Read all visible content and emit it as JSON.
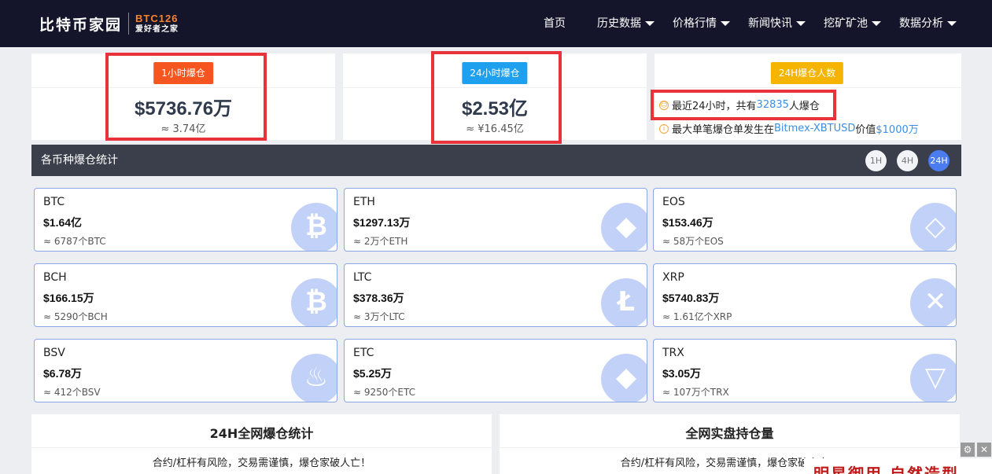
{
  "header": {
    "logo_cn": "比特币家园",
    "logo_en": "BTC126",
    "logo_sub": "爱好者之家",
    "nav": [
      {
        "label": "首页",
        "dropdown": false
      },
      {
        "label": "历史数据",
        "dropdown": true
      },
      {
        "label": "价格行情",
        "dropdown": true
      },
      {
        "label": "新闻快讯",
        "dropdown": true
      },
      {
        "label": "挖矿矿池",
        "dropdown": true
      },
      {
        "label": "数据分析",
        "dropdown": true
      }
    ]
  },
  "summary": {
    "one_hour": {
      "label": "1小时爆仓",
      "value": "$5736.76万",
      "sub": "≈ 3.74亿",
      "color": "#f5561f"
    },
    "twenty_four_hour": {
      "label": "24小时爆仓",
      "value": "$2.53亿",
      "sub": "≈ ¥16.45亿",
      "color": "#1fa0ef"
    },
    "people": {
      "label": "24H爆仓人数",
      "color": "#f5b400",
      "line1_prefix": "最近24小时，共有",
      "line1_count": "32835",
      "line1_suffix": "人爆仓",
      "line2_prefix": "最大单笔爆仓单发生在",
      "line2_exchange": "Bitmex-XBTUSD",
      "line2_mid": "价值",
      "line2_value": "$1000万"
    }
  },
  "stats": {
    "title": "各币种爆仓统计",
    "periods": [
      "1H",
      "4H",
      "24H"
    ],
    "active_period": "24H"
  },
  "coins": [
    {
      "name": "BTC",
      "usd": "$1.64亿",
      "amount": "≈ 6787个BTC",
      "icon": "bitcoin-icon"
    },
    {
      "name": "ETH",
      "usd": "$1297.13万",
      "amount": "≈ 2万个ETH",
      "icon": "ethereum-icon"
    },
    {
      "name": "EOS",
      "usd": "$153.46万",
      "amount": "≈ 58万个EOS",
      "icon": "eos-icon"
    },
    {
      "name": "BCH",
      "usd": "$166.15万",
      "amount": "≈ 5290个BCH",
      "icon": "bitcoin-cash-icon"
    },
    {
      "name": "LTC",
      "usd": "$378.36万",
      "amount": "≈ 3万个LTC",
      "icon": "litecoin-icon"
    },
    {
      "name": "XRP",
      "usd": "$5740.83万",
      "amount": "≈ 1.61亿个XRP",
      "icon": "ripple-icon"
    },
    {
      "name": "BSV",
      "usd": "$6.78万",
      "amount": "≈ 412个BSV",
      "icon": "bitcoin-sv-icon"
    },
    {
      "name": "ETC",
      "usd": "$5.25万",
      "amount": "≈ 9250个ETC",
      "icon": "ethereum-classic-icon"
    },
    {
      "name": "TRX",
      "usd": "$3.05万",
      "amount": "≈ 107万个TRX",
      "icon": "tron-icon"
    }
  ],
  "bottom": {
    "left_title": "24H全网爆仓统计",
    "left_note": "合约/杠杆有风险，交易需谨慎，爆仓家破人亡！",
    "right_title": "全网实盘持仓量",
    "right_note": "合约/杠杆有风险，交易需谨慎，爆仓家破人亡！"
  },
  "ad": {
    "text": "明星御用 自然造型"
  },
  "colors": {
    "header_bg": "#14142a",
    "accent_blue": "#4a7cf0",
    "link": "#3a8ee6",
    "highlight_box": "#e8333a"
  }
}
